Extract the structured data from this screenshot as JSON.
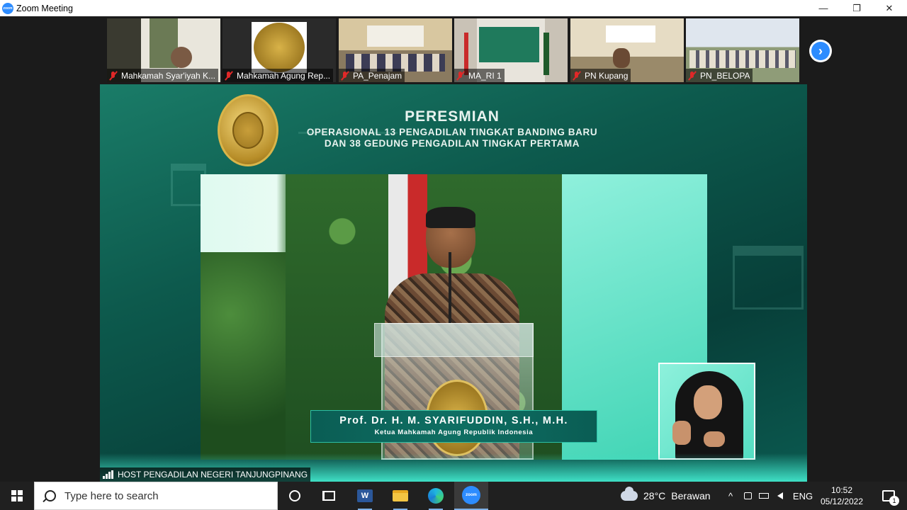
{
  "window": {
    "title": "Zoom Meeting",
    "controls": {
      "minimize": "—",
      "maximize": "❐",
      "close": "✕"
    }
  },
  "thumbnails": [
    {
      "name": "Mahkamah Syar'iyah K...",
      "muted": true,
      "scene": "room"
    },
    {
      "name": "Mahkamah Agung Rep...",
      "muted": true,
      "scene": "emblem"
    },
    {
      "name": "PA_Penajam",
      "muted": true,
      "scene": "room"
    },
    {
      "name": "MA_RI 1",
      "muted": true,
      "scene": "screen"
    },
    {
      "name": "PN Kupang",
      "muted": true,
      "scene": "room"
    },
    {
      "name": "PN_BELOPA",
      "muted": true,
      "scene": "room"
    }
  ],
  "next_button": {
    "icon": "chevron-right-icon",
    "label": "›"
  },
  "stage": {
    "title_line1": "PERESMIAN",
    "title_line2": "OPERASIONAL 13 PENGADILAN TINGKAT BANDING BARU",
    "title_line3": "DAN 38 GEDUNG PENGADILAN TINGKAT PERTAMA",
    "speaker_name": "Prof. Dr. H. M. SYARIFUDDIN, S.H., M.H.",
    "speaker_role": "Ketua Mahkamah Agung Republik Indonesia"
  },
  "host_label": "HOST PENGADILAN NEGERI TANJUNGPINANG",
  "taskbar": {
    "search_placeholder": "Type here to search",
    "word_letter": "W",
    "zoom_letter": "zoom",
    "weather_temp": "28°C",
    "weather_desc": "Berawan",
    "tray_up": "^",
    "language": "ENG",
    "time": "10:52",
    "date": "05/12/2022",
    "notification_count": "1"
  }
}
